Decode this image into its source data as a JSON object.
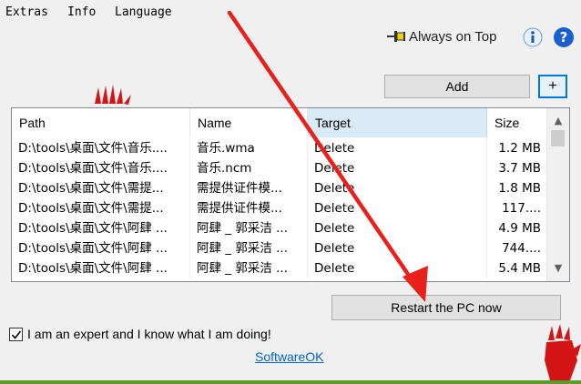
{
  "menu": [
    "Extras",
    "Info",
    "Language"
  ],
  "toolbar": {
    "always_on_top": "Always on Top",
    "info_icon": "info-icon",
    "help_icon": "help-icon",
    "help_glyph": "?"
  },
  "buttons": {
    "add": "Add",
    "plus": "+",
    "restart": "Restart the PC now"
  },
  "table": {
    "columns": [
      "Path",
      "Name",
      "Target",
      "Size"
    ],
    "rows": [
      [
        "D:\\tools\\桌面\\文件\\音乐....",
        "音乐.wma",
        "Delete",
        "1.2 MB"
      ],
      [
        "D:\\tools\\桌面\\文件\\音乐....",
        "音乐.ncm",
        "Delete",
        "3.7 MB"
      ],
      [
        "D:\\tools\\桌面\\文件\\需提...",
        "需提供证件模...",
        "Delete",
        "1.8 MB"
      ],
      [
        "D:\\tools\\桌面\\文件\\需提...",
        "需提供证件模...",
        "Delete",
        "117...."
      ],
      [
        "D:\\tools\\桌面\\文件\\阿肆 ...",
        "阿肆 _ 郭采洁 ...",
        "Delete",
        "4.9 MB"
      ],
      [
        "D:\\tools\\桌面\\文件\\阿肆 ...",
        "阿肆 _ 郭采洁 ...",
        "Delete",
        "744...."
      ],
      [
        "D:\\tools\\桌面\\文件\\阿肆 ...",
        "阿肆 _ 郭采洁 ...",
        "Delete",
        "5.4 MB"
      ]
    ]
  },
  "expert_checkbox": {
    "label": "I am an expert and I know what I am doing!",
    "checked": true
  },
  "link": "SoftwareOK",
  "colors": {
    "accent": "#0078d7",
    "link": "#0066cc",
    "arrow": "#e8211d",
    "hand": "#d21414"
  }
}
